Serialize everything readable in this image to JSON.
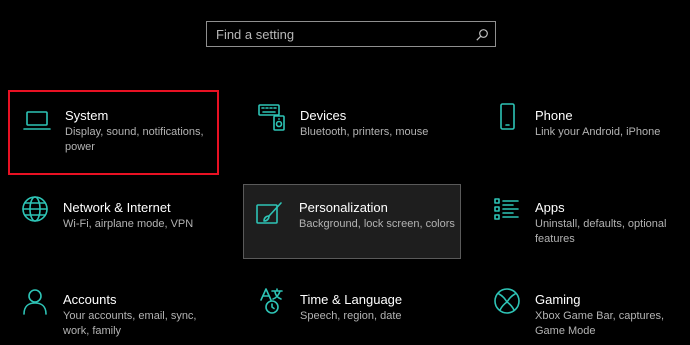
{
  "search": {
    "placeholder": "Find a setting"
  },
  "categories": [
    {
      "title": "System",
      "description": "Display, sound, notifications, power",
      "icon": "laptop-icon"
    },
    {
      "title": "Devices",
      "description": "Bluetooth, printers, mouse",
      "icon": "keyboard-speaker-icon"
    },
    {
      "title": "Phone",
      "description": "Link your Android, iPhone",
      "icon": "phone-icon"
    },
    {
      "title": "Network & Internet",
      "description": "Wi-Fi, airplane mode, VPN",
      "icon": "globe-icon"
    },
    {
      "title": "Personalization",
      "description": "Background, lock screen, colors",
      "icon": "paintbrush-icon"
    },
    {
      "title": "Apps",
      "description": "Uninstall, defaults, optional features",
      "icon": "apps-list-icon"
    },
    {
      "title": "Accounts",
      "description": "Your accounts, email, sync, work, family",
      "icon": "person-icon"
    },
    {
      "title": "Time & Language",
      "description": "Speech, region, date",
      "icon": "time-language-icon"
    },
    {
      "title": "Gaming",
      "description": "Xbox Game Bar, captures, Game Mode",
      "icon": "xbox-icon"
    }
  ],
  "colors": {
    "accent": "#2ec4b6",
    "highlight_border": "#e81123",
    "background": "#000000",
    "hover_tile": "#1e1e1e"
  }
}
